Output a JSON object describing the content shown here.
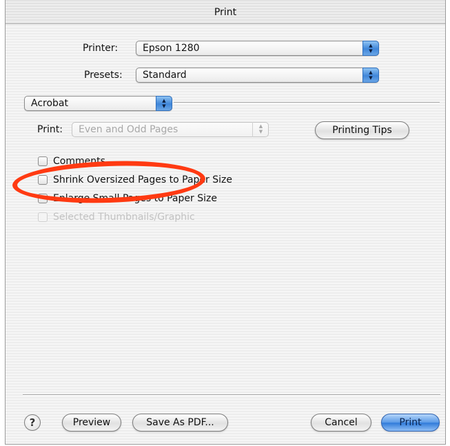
{
  "window": {
    "title": "Print"
  },
  "printer": {
    "label": "Printer:",
    "value": "Epson 1280"
  },
  "presets": {
    "label": "Presets:",
    "value": "Standard"
  },
  "panel": {
    "value": "Acrobat"
  },
  "print_range": {
    "label": "Print:",
    "value": "Even and Odd Pages",
    "disabled": true
  },
  "printing_tips_button": "Printing Tips",
  "checkboxes": [
    {
      "label": "Comments",
      "checked": false,
      "disabled": false
    },
    {
      "label": "Shrink Oversized Pages to Paper Size",
      "checked": false,
      "disabled": false
    },
    {
      "label": "Enlarge Small Pages to Paper Size",
      "checked": false,
      "disabled": false
    },
    {
      "label": "Selected Thumbnails/Graphic",
      "checked": false,
      "disabled": true
    }
  ],
  "footer": {
    "help": "?",
    "preview": "Preview",
    "save_as_pdf": "Save As PDF...",
    "cancel": "Cancel",
    "print": "Print"
  },
  "colors": {
    "annotation": "#ff3a12",
    "default_button": "#3f86d9"
  }
}
